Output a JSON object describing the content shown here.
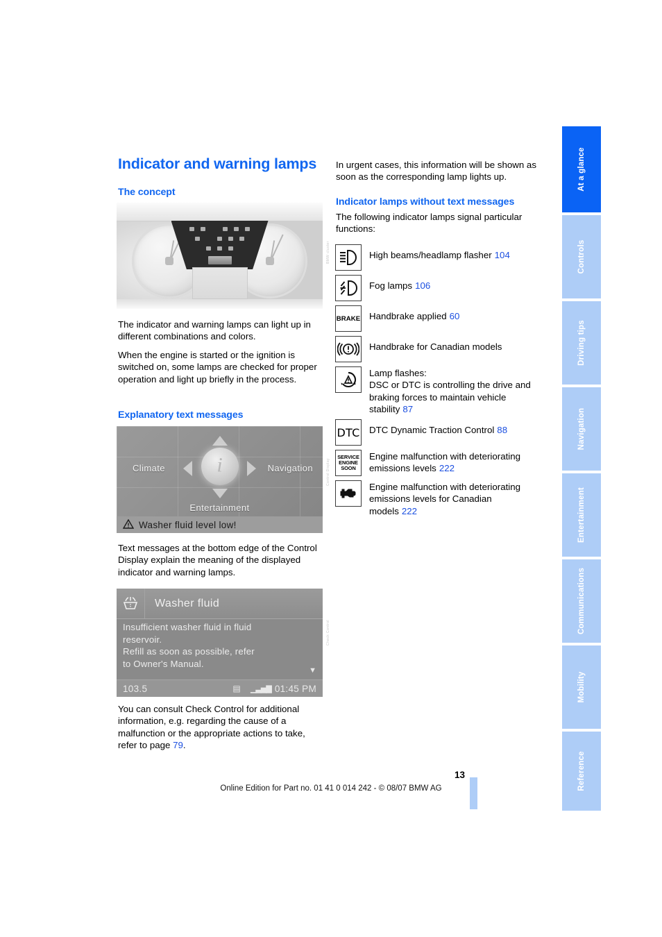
{
  "page": {
    "number": "13",
    "footer": "Online Edition for Part no. 01 41 0 014 242 - © 08/07 BMW AG"
  },
  "sidebar": {
    "tabs": [
      {
        "label": "At a glance",
        "active": true
      },
      {
        "label": "Controls",
        "active": false
      },
      {
        "label": "Driving tips",
        "active": false
      },
      {
        "label": "Navigation",
        "active": false
      },
      {
        "label": "Entertainment",
        "active": false
      },
      {
        "label": "Communications",
        "active": false
      },
      {
        "label": "Mobility",
        "active": false
      },
      {
        "label": "Reference",
        "active": false
      }
    ],
    "active_color": "#0a63f5",
    "inactive_color": "#aecdf7"
  },
  "left_column": {
    "title": "Indicator and warning lamps",
    "section_concept_heading": "The concept",
    "paragraph_1": "The indicator and warning lamps can light up in different combinations and colors.",
    "paragraph_2": "When the engine is started or the ignition is switched on, some lamps are checked for proper operation and light up briefly in the process.",
    "section_explanatory_heading": "Explanatory text messages",
    "paragraph_3": "Text messages at the bottom edge of the Control Display explain the meaning of the displayed indicator and warning lamps.",
    "paragraph_4_part1": "You can consult Check Control for additional information, e.g. regarding the cause of a malfunction or the appropriate actions to take, refer to page ",
    "paragraph_4_ref": "79",
    "paragraph_4_part2": "."
  },
  "figures": {
    "cluster": {
      "name": "instrument-cluster-photo"
    },
    "control_display": {
      "cell_climate": "Climate",
      "cell_navigation": "Navigation",
      "cell_entertainment": "Entertainment",
      "status_message": "Washer fluid level low!"
    },
    "washer_fluid": {
      "title": "Washer fluid",
      "body_line_1": "Insufficient washer fluid in fluid",
      "body_line_2": "reservoir.",
      "body_line_3": "Refill as soon as possible, refer",
      "body_line_4": "to Owner's Manual.",
      "status_frequency": "103.5",
      "status_clock": "01:45 PM",
      "scroll_indicator": "▼",
      "signal_icon": "signal-bars-icon",
      "disc_icon": "disc-icon"
    }
  },
  "right_column": {
    "intro_paragraph": "In urgent cases, this information will be shown as soon as the corresponding lamp lights up.",
    "heading": "Indicator lamps without text messages",
    "lead_paragraph": "The following indicator lamps signal particular functions:",
    "lamps": [
      {
        "icon": "high-beam-icon",
        "icon_text": "",
        "description": "High beams/headlamp flasher",
        "page_ref": "104"
      },
      {
        "icon": "fog-lamp-icon",
        "icon_text": "",
        "description": "Fog lamps",
        "page_ref": "106"
      },
      {
        "icon": "brake-text-icon",
        "icon_text": "BRAKE",
        "description": "Handbrake applied",
        "page_ref": "60"
      },
      {
        "icon": "handbrake-canadian-icon",
        "icon_text": "",
        "description": "Handbrake for Canadian models",
        "page_ref": ""
      },
      {
        "icon": "dsc-triangle-icon",
        "icon_text": "",
        "description": "Lamp flashes:\nDSC or DTC is controlling the drive and braking forces to maintain vehicle stability",
        "page_ref": "87"
      },
      {
        "icon": "dtc-text-icon",
        "icon_text": "DTC",
        "description": "DTC Dynamic Traction Control",
        "page_ref": "88"
      },
      {
        "icon": "service-engine-soon-icon",
        "icon_text": "SERVICE ENGINE SOON",
        "description": "Engine malfunction with deteriorating emissions levels",
        "page_ref": "222"
      },
      {
        "icon": "check-engine-icon",
        "icon_text": "",
        "description": "Engine malfunction with deteriorating emissions levels for Canadian models",
        "page_ref": "222"
      }
    ]
  }
}
